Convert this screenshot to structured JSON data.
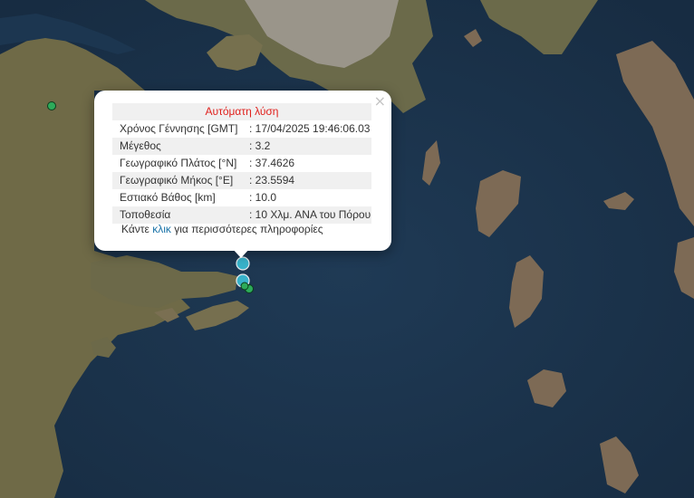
{
  "map": {
    "markers": [
      {
        "label": "eq-1",
        "color": "#3cc0d8"
      },
      {
        "label": "eq-2",
        "color": "#3cc0d8"
      },
      {
        "label": "eq-3",
        "color": "#2dab5a"
      },
      {
        "label": "eq-4",
        "color": "#2dab5a"
      },
      {
        "label": "eq-5",
        "color": "#2dab5a"
      }
    ]
  },
  "popup": {
    "title": "Αυτόματη λύση",
    "close": "×",
    "rows": [
      {
        "key": "Χρόνος Γέννησης [GMT]",
        "value": ": 17/04/2025 19:46:06.03"
      },
      {
        "key": "Μέγεθος",
        "value": ": 3.2"
      },
      {
        "key": "Γεωγραφικό Πλάτος [°N]",
        "value": ": 37.4626"
      },
      {
        "key": "Γεωγραφικό Μήκος [°E]",
        "value": ": 23.5594"
      },
      {
        "key": "Εστιακό Βάθος [km]",
        "value": ": 10.0"
      },
      {
        "key": "Τοποθεσία",
        "value": ": 10 Χλμ. ΑΝΑ του Πόρου"
      }
    ],
    "footer": {
      "prefix": "Κάντε",
      "link": "κλικ",
      "suffix": "για περισσότερες πληροφορίες"
    }
  }
}
